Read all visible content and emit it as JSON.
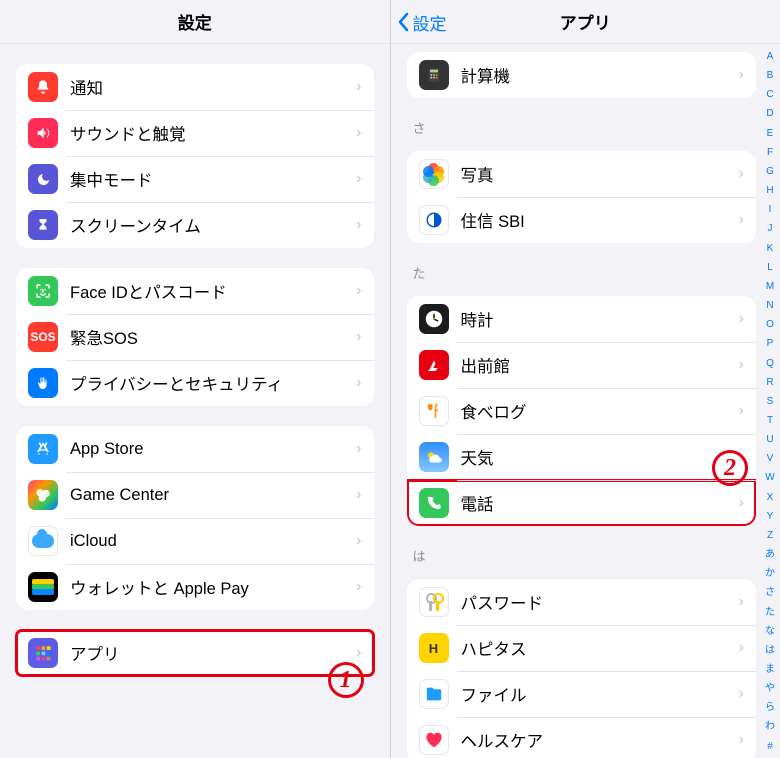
{
  "left": {
    "title": "設定",
    "groups": [
      {
        "rows": [
          {
            "id": "notifications",
            "label": "通知",
            "icon": "bell"
          },
          {
            "id": "sound",
            "label": "サウンドと触覚",
            "icon": "sound"
          },
          {
            "id": "focus",
            "label": "集中モード",
            "icon": "focus"
          },
          {
            "id": "screentime",
            "label": "スクリーンタイム",
            "icon": "screen"
          }
        ]
      },
      {
        "rows": [
          {
            "id": "faceid",
            "label": "Face IDとパスコード",
            "icon": "faceid"
          },
          {
            "id": "sos",
            "label": "緊急SOS",
            "icon": "sos"
          },
          {
            "id": "privacy",
            "label": "プライバシーとセキュリティ",
            "icon": "privacy"
          }
        ]
      },
      {
        "rows": [
          {
            "id": "appstore",
            "label": "App Store",
            "icon": "appstore"
          },
          {
            "id": "gamecenter",
            "label": "Game Center",
            "icon": "gc"
          },
          {
            "id": "icloud",
            "label": "iCloud",
            "icon": "icloud"
          },
          {
            "id": "wallet",
            "label": "ウォレットと Apple Pay",
            "icon": "wallet"
          }
        ]
      },
      {
        "rows": [
          {
            "id": "apps",
            "label": "アプリ",
            "icon": "apps",
            "highlight": true
          }
        ]
      }
    ],
    "callout": "1"
  },
  "right": {
    "title": "アプリ",
    "back_label": "設定",
    "sections": [
      {
        "label": null,
        "rows": [
          {
            "id": "calc",
            "label": "計算機",
            "icon": "calc"
          }
        ]
      },
      {
        "label": "さ",
        "rows": [
          {
            "id": "photos",
            "label": "写真",
            "icon": "photos"
          },
          {
            "id": "sbi",
            "label": "住信 SBI",
            "icon": "sbi"
          }
        ]
      },
      {
        "label": "た",
        "rows": [
          {
            "id": "clock",
            "label": "時計",
            "icon": "clock"
          },
          {
            "id": "demae",
            "label": "出前館",
            "icon": "demae"
          },
          {
            "id": "tabelog",
            "label": "食べログ",
            "icon": "tabelog"
          },
          {
            "id": "weather",
            "label": "天気",
            "icon": "weather"
          },
          {
            "id": "phone",
            "label": "電話",
            "icon": "phone",
            "highlight": true
          }
        ]
      },
      {
        "label": "は",
        "rows": [
          {
            "id": "passwords",
            "label": "パスワード",
            "icon": "passwd"
          },
          {
            "id": "hapitas",
            "label": "ハピタス",
            "icon": "hapitas"
          },
          {
            "id": "files",
            "label": "ファイル",
            "icon": "files"
          },
          {
            "id": "health",
            "label": "ヘルスケア",
            "icon": "health"
          }
        ]
      }
    ],
    "callout": "2",
    "index_rail": [
      "A",
      "B",
      "C",
      "D",
      "E",
      "F",
      "G",
      "H",
      "I",
      "J",
      "K",
      "L",
      "M",
      "N",
      "O",
      "P",
      "Q",
      "R",
      "S",
      "T",
      "U",
      "V",
      "W",
      "X",
      "Y",
      "Z",
      "あ",
      "か",
      "さ",
      "た",
      "な",
      "は",
      "ま",
      "や",
      "ら",
      "わ",
      "#"
    ]
  }
}
